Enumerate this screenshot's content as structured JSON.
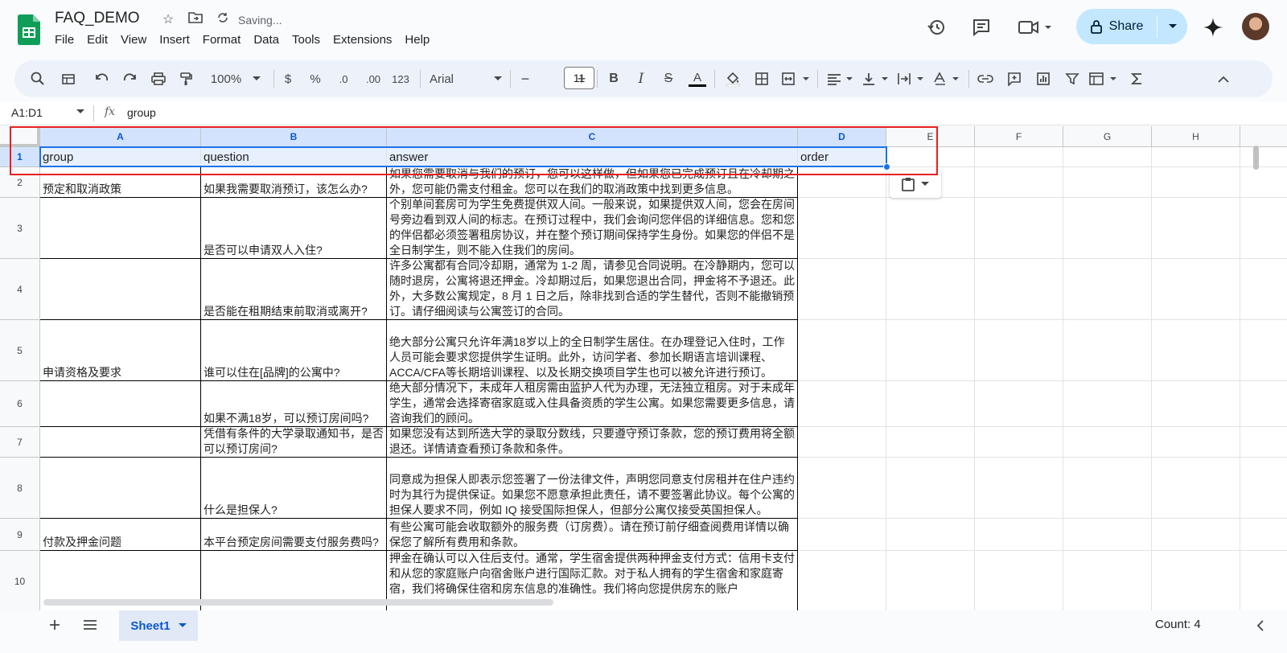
{
  "app": {
    "doc_title": "FAQ_DEMO",
    "saving_status": "Saving...",
    "menu": [
      "File",
      "Edit",
      "View",
      "Insert",
      "Format",
      "Data",
      "Tools",
      "Extensions",
      "Help"
    ],
    "share_label": "Share"
  },
  "toolbar": {
    "zoom": "100%",
    "currency": "$",
    "percent": "%",
    "decrease_decimal": ".0",
    "increase_decimal": ".00",
    "number_format": "123",
    "font": "Arial",
    "font_size": "11",
    "bold": "B",
    "italic": "I",
    "strike": "S",
    "text_color": "A",
    "minus": "−",
    "plus": "+"
  },
  "formula_bar": {
    "name_box": "A1:D1",
    "fx": "fx",
    "formula": "group"
  },
  "columns": [
    "A",
    "B",
    "C",
    "D",
    "E",
    "F",
    "G",
    "H"
  ],
  "rows": [
    {
      "num": "1",
      "group": "group",
      "question": "question",
      "answer": "answer",
      "order": "order"
    },
    {
      "num": "2",
      "group": "预定和取消政策",
      "question": "如果我需要取消预订，该怎么办?",
      "answer": "如果您需要取消与我们的预订，您可以这样做，但如果您已完成预订且在冷却期之外，您可能仍需支付租金。您可以在我们的取消政策中找到更多信息。",
      "order": ""
    },
    {
      "num": "3",
      "group": "",
      "question": "是否可以申请双人入住?",
      "answer": "个别单间套房可为学生免费提供双人间。一般来说，如果提供双人间，您会在房间号旁边看到双人间的标志。在预订过程中，我们会询问您伴侣的详细信息。您和您的伴侣都必须签署租房协议，并在整个预订期间保持学生身份。如果您的伴侣不是全日制学生，则不能入住我们的房间。",
      "order": ""
    },
    {
      "num": "4",
      "group": "",
      "question": "是否能在租期结束前取消或离开?",
      "answer": "许多公寓都有合同冷却期，通常为 1-2 周，请参见合同说明。在冷静期内，您可以随时退房，公寓将退还押金。冷却期过后，如果您退出合同，押金将不予退还。此外，大多数公寓规定，8 月 1 日之后，除非找到合适的学生替代，否则不能撤销预订。请仔细阅读与公寓签订的合同。",
      "order": ""
    },
    {
      "num": "5",
      "group": "申请资格及要求",
      "question": "谁可以住在[品牌]的公寓中?",
      "answer": "绝大部分公寓只允许年满18岁以上的全日制学生居住。在办理登记入住时，工作人员可能会要求您提供学生证明。此外，访问学者、参加长期语言培训课程、ACCA/CFA等长期培训课程、以及长期交换项目学生也可以被允许进行预订。",
      "order": ""
    },
    {
      "num": "6",
      "group": "",
      "question": "如果不满18岁，可以预订房间吗?",
      "answer": "绝大部分情况下，未成年人租房需由监护人代为办理，无法独立租房。对于未成年学生，通常会选择寄宿家庭或入住具备资质的学生公寓。如果您需要更多信息，请咨询我们的顾问。",
      "order": ""
    },
    {
      "num": "7",
      "group": "",
      "question": "凭借有条件的大学录取通知书，是否可以预订房间?",
      "answer": "如果您没有达到所选大学的录取分数线，只要遵守预订条款，您的预订费用将全额退还。详情请查看预订条款和条件。",
      "order": ""
    },
    {
      "num": "8",
      "group": "",
      "question": "什么是担保人?",
      "answer": "同意成为担保人即表示您签署了一份法律文件，声明您同意支付房租并在住户违约时为其行为提供保证。如果您不愿意承担此责任，请不要签署此协议。每个公寓的担保人要求不同，例如 IQ 接受国际担保人，但部分公寓仅接受英国担保人。",
      "order": ""
    },
    {
      "num": "9",
      "group": "付款及押金问题",
      "question": "本平台预定房间需要支付服务费吗?",
      "answer": "有些公寓可能会收取额外的服务费（订房费）。请在预订前仔细查阅费用详情以确保您了解所有费用和条款。",
      "order": ""
    },
    {
      "num": "10",
      "group": "",
      "question": "",
      "answer": "押金在确认可以入住后支付。通常，学生宿舍提供两种押金支付方式：信用卡支付和从您的家庭账户向宿舍账户进行国际汇款。对于私人拥有的学生宿舍和家庭寄宿，我们将确保住宿和房东信息的准确性。我们将向您提供房东的账户",
      "order": ""
    }
  ],
  "bottom": {
    "sheet_name": "Sheet1",
    "count": "Count: 4"
  },
  "colors": {
    "accent": "#0b57d0",
    "selection": "#1a73e8",
    "share_bg": "#c2e7ff",
    "annotation_box": "#e8201f"
  }
}
